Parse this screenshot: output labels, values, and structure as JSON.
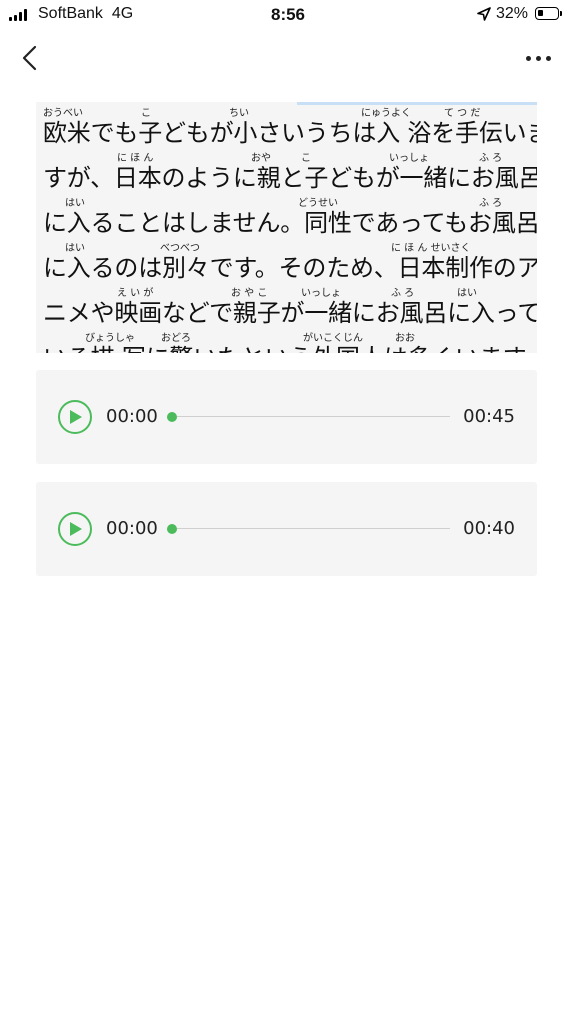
{
  "status": {
    "carrier": "SoftBank",
    "network": "4G",
    "time": "8:56",
    "battery": "32%",
    "battery_level": 0.32
  },
  "nav": {
    "back_icon": "chevron-left-icon",
    "more_icon": "ellipsis-icon"
  },
  "reading": {
    "progress_fraction": 0.48,
    "lines": [
      {
        "text": "欧米でも子どもが小さいうちは入 浴を手伝いま",
        "ruby": [
          {
            "t": "おうべい"
          },
          {
            "t": "こ"
          },
          {
            "t": "ちい"
          },
          {
            "t": "にゅうよく"
          },
          {
            "t": "て つ だ"
          }
        ]
      },
      {
        "text": "すが、日本のように親と子どもが一緒にお風呂",
        "ruby": [
          {
            "t": "に ほ ん"
          },
          {
            "t": "おや"
          },
          {
            "t": "こ"
          },
          {
            "t": "いっしょ"
          },
          {
            "t": "ふ ろ"
          }
        ]
      },
      {
        "text": "に入ることはしません。同性であってもお風呂",
        "ruby": [
          {
            "t": "はい"
          },
          {
            "t": "どうせい"
          },
          {
            "t": "ふ ろ"
          }
        ]
      },
      {
        "text": "に入るのは別々です。そのため、日本制作のア",
        "ruby": [
          {
            "t": "はい"
          },
          {
            "t": "べつべつ"
          },
          {
            "t": "に ほ ん せいさく"
          }
        ]
      },
      {
        "text": "ニメや映画などで親子が一緒にお風呂に入って",
        "ruby": [
          {
            "t": "え い が"
          },
          {
            "t": "お や こ"
          },
          {
            "t": "いっしょ"
          },
          {
            "t": "ふ ろ"
          },
          {
            "t": "はい"
          }
        ]
      },
      {
        "text": "いる描 写に驚いたという外国人は多くいます。",
        "ruby": [
          {
            "t": "びょうしゃ"
          },
          {
            "t": "おどろ"
          },
          {
            "t": "がいこくじん"
          },
          {
            "t": "おお"
          }
        ]
      }
    ]
  },
  "audio": [
    {
      "current": "00:00",
      "duration": "00:45",
      "play_icon": "play-icon",
      "position": 0
    },
    {
      "current": "00:00",
      "duration": "00:40",
      "play_icon": "play-icon",
      "position": 0
    }
  ],
  "colors": {
    "accent": "#4cbb5c",
    "card_bg": "#f5f5f5",
    "progress": "#c9dff5"
  }
}
